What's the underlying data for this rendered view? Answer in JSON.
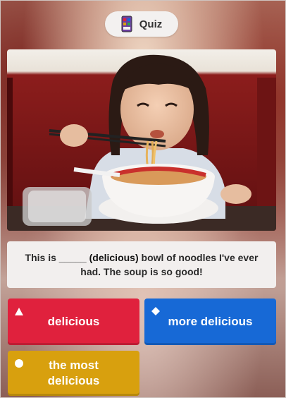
{
  "header": {
    "quiz_label": "Quiz",
    "icon": "quiz-cards-icon"
  },
  "photo": {
    "icon": "photo-image"
  },
  "question": {
    "part1": "This is _____ ",
    "bold": "(delicious)",
    "part2": " bowl of noodles I've ever had. The soup is so good!"
  },
  "answers": [
    {
      "label": "delicious",
      "shape": "triangle-icon",
      "color": "#e0213d"
    },
    {
      "label": "more delicious",
      "shape": "diamond-icon",
      "color": "#1769d6"
    },
    {
      "label": "the most delicious",
      "shape": "circle-icon",
      "color": "#d8a00e"
    }
  ]
}
